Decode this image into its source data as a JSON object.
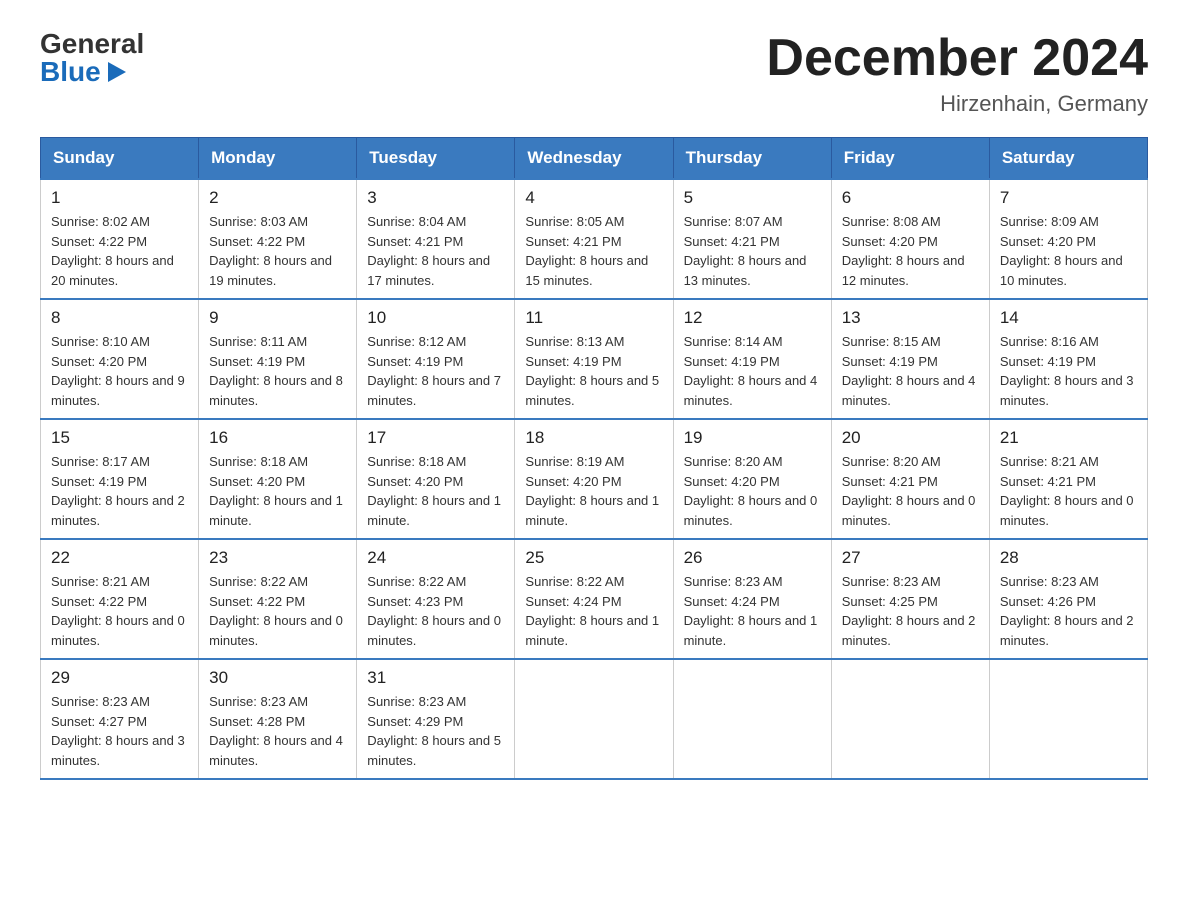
{
  "header": {
    "logo_general": "General",
    "logo_blue": "Blue",
    "main_title": "December 2024",
    "subtitle": "Hirzenhain, Germany"
  },
  "calendar": {
    "days_of_week": [
      "Sunday",
      "Monday",
      "Tuesday",
      "Wednesday",
      "Thursday",
      "Friday",
      "Saturday"
    ],
    "weeks": [
      [
        {
          "day": "1",
          "sunrise": "8:02 AM",
          "sunset": "4:22 PM",
          "daylight": "8 hours and 20 minutes."
        },
        {
          "day": "2",
          "sunrise": "8:03 AM",
          "sunset": "4:22 PM",
          "daylight": "8 hours and 19 minutes."
        },
        {
          "day": "3",
          "sunrise": "8:04 AM",
          "sunset": "4:21 PM",
          "daylight": "8 hours and 17 minutes."
        },
        {
          "day": "4",
          "sunrise": "8:05 AM",
          "sunset": "4:21 PM",
          "daylight": "8 hours and 15 minutes."
        },
        {
          "day": "5",
          "sunrise": "8:07 AM",
          "sunset": "4:21 PM",
          "daylight": "8 hours and 13 minutes."
        },
        {
          "day": "6",
          "sunrise": "8:08 AM",
          "sunset": "4:20 PM",
          "daylight": "8 hours and 12 minutes."
        },
        {
          "day": "7",
          "sunrise": "8:09 AM",
          "sunset": "4:20 PM",
          "daylight": "8 hours and 10 minutes."
        }
      ],
      [
        {
          "day": "8",
          "sunrise": "8:10 AM",
          "sunset": "4:20 PM",
          "daylight": "8 hours and 9 minutes."
        },
        {
          "day": "9",
          "sunrise": "8:11 AM",
          "sunset": "4:19 PM",
          "daylight": "8 hours and 8 minutes."
        },
        {
          "day": "10",
          "sunrise": "8:12 AM",
          "sunset": "4:19 PM",
          "daylight": "8 hours and 7 minutes."
        },
        {
          "day": "11",
          "sunrise": "8:13 AM",
          "sunset": "4:19 PM",
          "daylight": "8 hours and 5 minutes."
        },
        {
          "day": "12",
          "sunrise": "8:14 AM",
          "sunset": "4:19 PM",
          "daylight": "8 hours and 4 minutes."
        },
        {
          "day": "13",
          "sunrise": "8:15 AM",
          "sunset": "4:19 PM",
          "daylight": "8 hours and 4 minutes."
        },
        {
          "day": "14",
          "sunrise": "8:16 AM",
          "sunset": "4:19 PM",
          "daylight": "8 hours and 3 minutes."
        }
      ],
      [
        {
          "day": "15",
          "sunrise": "8:17 AM",
          "sunset": "4:19 PM",
          "daylight": "8 hours and 2 minutes."
        },
        {
          "day": "16",
          "sunrise": "8:18 AM",
          "sunset": "4:20 PM",
          "daylight": "8 hours and 1 minute."
        },
        {
          "day": "17",
          "sunrise": "8:18 AM",
          "sunset": "4:20 PM",
          "daylight": "8 hours and 1 minute."
        },
        {
          "day": "18",
          "sunrise": "8:19 AM",
          "sunset": "4:20 PM",
          "daylight": "8 hours and 1 minute."
        },
        {
          "day": "19",
          "sunrise": "8:20 AM",
          "sunset": "4:20 PM",
          "daylight": "8 hours and 0 minutes."
        },
        {
          "day": "20",
          "sunrise": "8:20 AM",
          "sunset": "4:21 PM",
          "daylight": "8 hours and 0 minutes."
        },
        {
          "day": "21",
          "sunrise": "8:21 AM",
          "sunset": "4:21 PM",
          "daylight": "8 hours and 0 minutes."
        }
      ],
      [
        {
          "day": "22",
          "sunrise": "8:21 AM",
          "sunset": "4:22 PM",
          "daylight": "8 hours and 0 minutes."
        },
        {
          "day": "23",
          "sunrise": "8:22 AM",
          "sunset": "4:22 PM",
          "daylight": "8 hours and 0 minutes."
        },
        {
          "day": "24",
          "sunrise": "8:22 AM",
          "sunset": "4:23 PM",
          "daylight": "8 hours and 0 minutes."
        },
        {
          "day": "25",
          "sunrise": "8:22 AM",
          "sunset": "4:24 PM",
          "daylight": "8 hours and 1 minute."
        },
        {
          "day": "26",
          "sunrise": "8:23 AM",
          "sunset": "4:24 PM",
          "daylight": "8 hours and 1 minute."
        },
        {
          "day": "27",
          "sunrise": "8:23 AM",
          "sunset": "4:25 PM",
          "daylight": "8 hours and 2 minutes."
        },
        {
          "day": "28",
          "sunrise": "8:23 AM",
          "sunset": "4:26 PM",
          "daylight": "8 hours and 2 minutes."
        }
      ],
      [
        {
          "day": "29",
          "sunrise": "8:23 AM",
          "sunset": "4:27 PM",
          "daylight": "8 hours and 3 minutes."
        },
        {
          "day": "30",
          "sunrise": "8:23 AM",
          "sunset": "4:28 PM",
          "daylight": "8 hours and 4 minutes."
        },
        {
          "day": "31",
          "sunrise": "8:23 AM",
          "sunset": "4:29 PM",
          "daylight": "8 hours and 5 minutes."
        },
        null,
        null,
        null,
        null
      ]
    ]
  }
}
